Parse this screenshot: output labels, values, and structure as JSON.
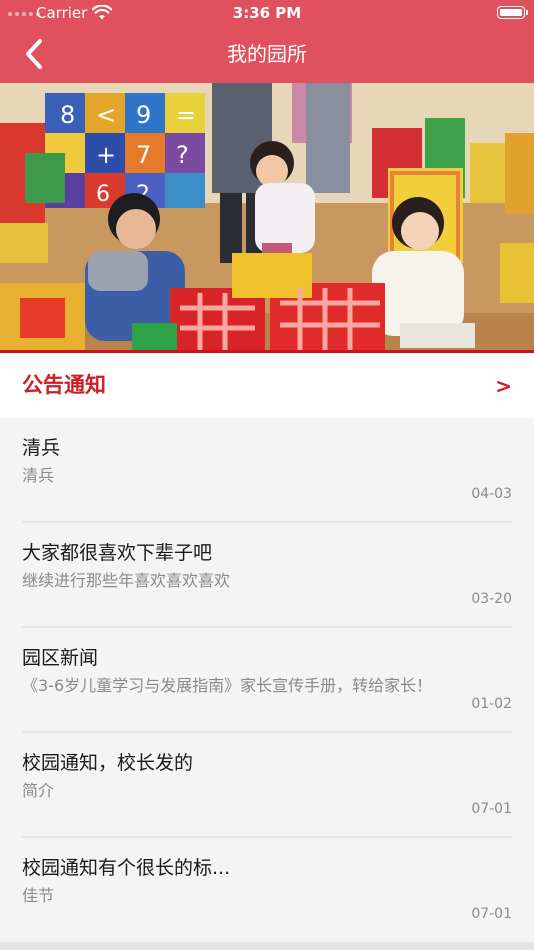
{
  "status_bar": {
    "carrier": "Carrier",
    "time": "3:36 PM"
  },
  "nav": {
    "title": "我的园所",
    "back_icon": "chevron-left-icon"
  },
  "banner": {
    "description_icon": "kindergarten-photo"
  },
  "notice_section": {
    "title": "公告通知",
    "more": ">"
  },
  "news": [
    {
      "title": "清兵",
      "subtitle": "清兵",
      "date": "04-03"
    },
    {
      "title": "大家都很喜欢下辈子吧",
      "subtitle": "继续进行那些年喜欢喜欢喜欢",
      "date": "03-20"
    },
    {
      "title": "园区新闻",
      "subtitle": "《3-6岁儿童学习与发展指南》家长宣传手册，转给家长！",
      "date": "01-02"
    },
    {
      "title": "校园通知，校长发的",
      "subtitle": "简介",
      "date": "07-01"
    },
    {
      "title": "校园通知有个很长的标...",
      "subtitle": "佳节",
      "date": "07-01"
    }
  ],
  "colors": {
    "header": "#e0505e",
    "accent": "#cf1d25",
    "background": "#f4f4f4"
  }
}
